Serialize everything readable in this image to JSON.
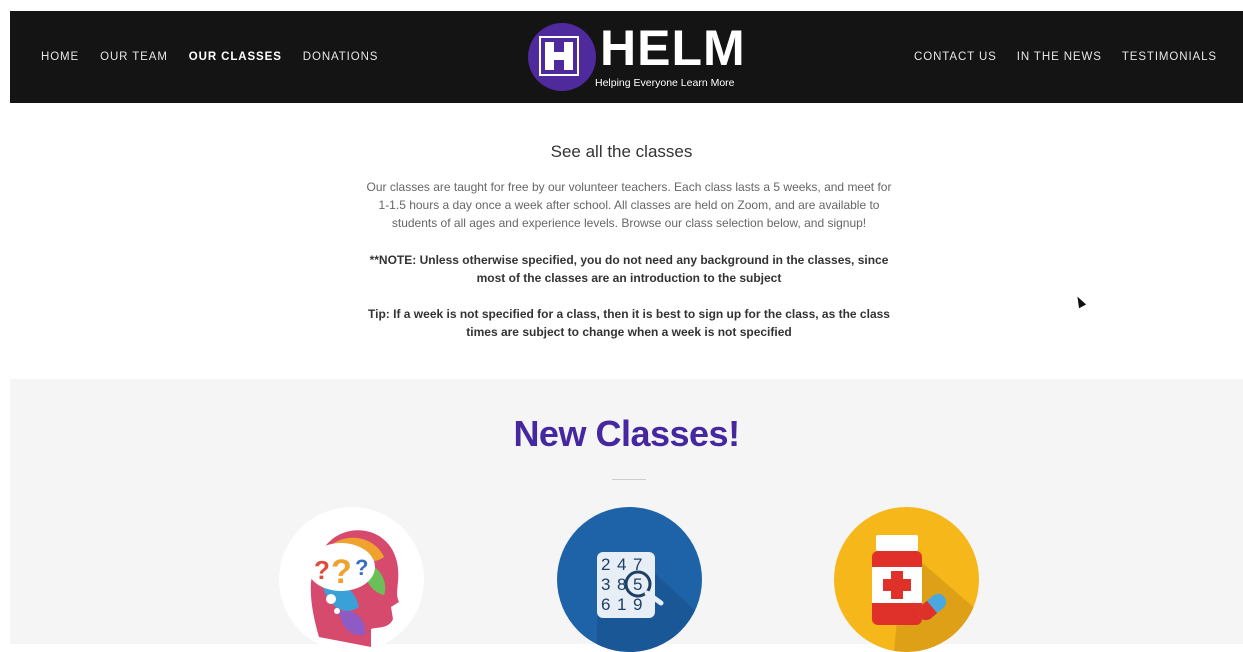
{
  "nav": {
    "left": [
      {
        "label": "HOME",
        "active": false
      },
      {
        "label": "OUR TEAM",
        "active": false
      },
      {
        "label": "OUR CLASSES",
        "active": true
      },
      {
        "label": "DONATIONS",
        "active": false
      }
    ],
    "right": [
      {
        "label": "CONTACT US"
      },
      {
        "label": "IN THE NEWS"
      },
      {
        "label": "TESTIMONIALS"
      }
    ],
    "logo": {
      "word": "HELM",
      "tagline": "Helping Everyone Learn More"
    }
  },
  "intro": {
    "heading": "See all the classes",
    "paragraph": "Our classes are taught for free by our volunteer teachers. Each class lasts a 5 weeks, and meet for 1-1.5 hours a day once a week after school. All classes are held on Zoom, and are available to students of all ages and experience levels. Browse our class selection below, and signup!",
    "note": "**NOTE: Unless otherwise specified, you do not need any background in the classes, since most of the classes are an introduction to the subject",
    "tip": "Tip: If a week is not specified for a class, then it is best to sign up for the class, as the class times are subject to change when a week is not specified"
  },
  "new_classes": {
    "title": "New Classes!",
    "icons": [
      "brain-question-icon",
      "number-grid-magnifier-icon",
      "medicine-bottle-icon"
    ]
  },
  "colors": {
    "nav_bg": "#141414",
    "brand_purple": "#4527a0",
    "section_bg": "#f5f5f5",
    "icon_blue": "#1e63a8",
    "icon_yellow": "#f5b71a"
  }
}
